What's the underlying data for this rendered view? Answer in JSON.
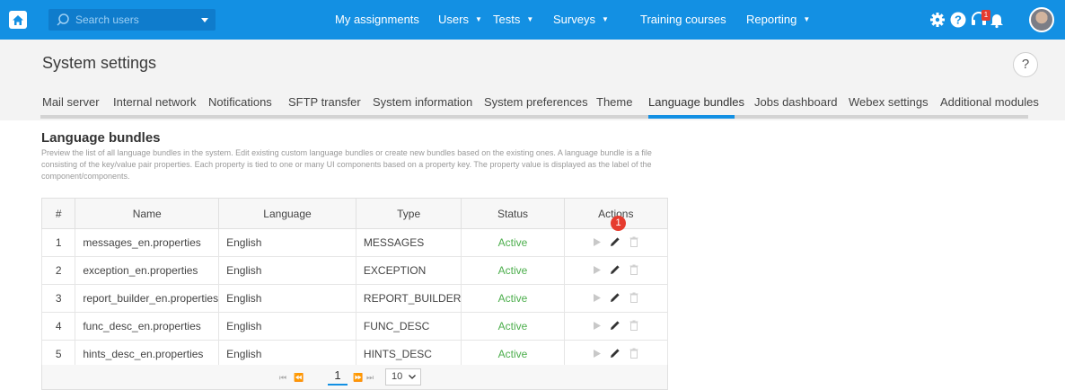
{
  "topbar": {
    "search_placeholder": "Search users",
    "nav": [
      {
        "label": "My assignments",
        "dropdown": false
      },
      {
        "label": "Users",
        "dropdown": true
      },
      {
        "label": "Tests",
        "dropdown": true
      },
      {
        "label": "Surveys",
        "dropdown": true
      },
      {
        "label": "Training courses",
        "dropdown": false
      },
      {
        "label": "Reporting",
        "dropdown": true
      }
    ],
    "caret": "▼",
    "notification_badge": "1",
    "icons": [
      "home-icon",
      "search-icon",
      "gear-icon",
      "help-icon",
      "headset-icon",
      "bell-icon",
      "avatar"
    ]
  },
  "header": {
    "title": "System settings",
    "help": "?",
    "tabs": [
      "Mail server",
      "Internal network",
      "Notifications",
      "SFTP transfer",
      "System information",
      "System preferences",
      "Theme",
      "Language bundles",
      "Jobs dashboard",
      "Webex settings",
      "Additional modules"
    ],
    "active_tab": "Language bundles"
  },
  "main": {
    "title": "Language bundles",
    "description": "Preview the list of all language bundles in the system. Edit existing custom language bundles or create new bundles based on the existing ones. A language bundle is a file consisting of the key/value pair properties. Each property is tied to one or many UI components based on a property key. The property value is displayed as the label of the component/components.",
    "columns": [
      "#",
      "Name",
      "Language",
      "Type",
      "Status",
      "Actions"
    ],
    "rows": [
      {
        "num": "1",
        "name": "messages_en.properties",
        "language": "English",
        "type": "MESSAGES",
        "status": "Active"
      },
      {
        "num": "2",
        "name": "exception_en.properties",
        "language": "English",
        "type": "EXCEPTION",
        "status": "Active"
      },
      {
        "num": "3",
        "name": "report_builder_en.properties",
        "language": "English",
        "type": "REPORT_BUILDER",
        "status": "Active"
      },
      {
        "num": "4",
        "name": "func_desc_en.properties",
        "language": "English",
        "type": "FUNC_DESC",
        "status": "Active"
      },
      {
        "num": "5",
        "name": "hints_desc_en.properties",
        "language": "English",
        "type": "HINTS_DESC",
        "status": "Active"
      }
    ],
    "pagination": {
      "first": "⏮",
      "prev": "⏪",
      "current_page": "1",
      "next": "⏩",
      "last": "⏭",
      "page_size": "10"
    },
    "step_marker": "1"
  },
  "colors": {
    "primary": "#1390e3",
    "active_status": "#4cae4c",
    "badge": "#e63b2e"
  }
}
